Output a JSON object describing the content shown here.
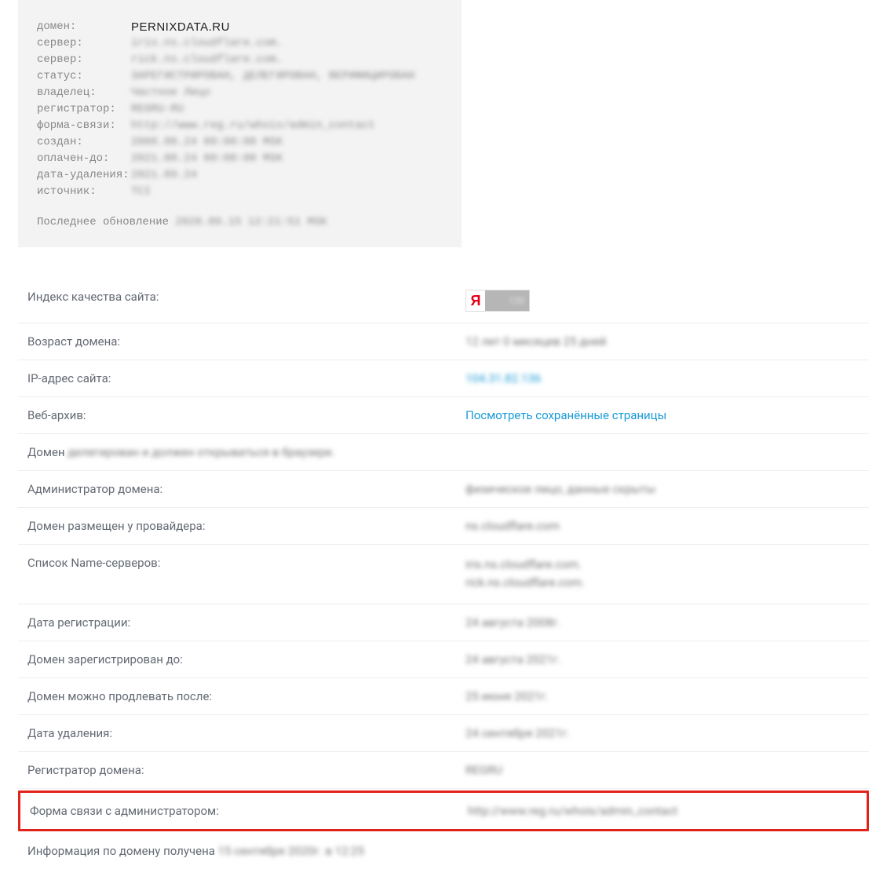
{
  "whois": {
    "rows": [
      {
        "label": "домен:",
        "value": "PERNIXDATA.RU",
        "clear": true
      },
      {
        "label": "сервер:",
        "value": "iris.ns.cloudflare.com."
      },
      {
        "label": "сервер:",
        "value": "rick.ns.cloudflare.com."
      },
      {
        "label": "статус:",
        "value": "ЗАРЕГИСТРИРОВАН, ДЕЛЕГИРОВАН, ВЕРИФИЦИРОВАН"
      },
      {
        "label": "владелец:",
        "value": "Частное Лицо"
      },
      {
        "label": "регистратор:",
        "value": "REGRU-RU"
      },
      {
        "label": "форма-связи:",
        "value": "http://www.reg.ru/whois/admin_contact"
      },
      {
        "label": "создан:",
        "value": "2008.08.24 00:00:00 MSK"
      },
      {
        "label": "оплачен-до:",
        "value": "2021.08.24 00:00:00 MSK"
      },
      {
        "label": "дата-удаления:",
        "value": "2021.09.24"
      },
      {
        "label": "источник:",
        "value": "TCI"
      }
    ],
    "footer_prefix": "Последнее обновление ",
    "footer_value": "2020.09.15 12:21:51 MSK"
  },
  "info": {
    "yandex_label": "Индекс качества сайта:",
    "yandex_y": "Я",
    "yandex_value": "120",
    "age_label": "Возраст домена:",
    "age_value": "12 лет 0 месяцев 25 дней",
    "ip_label": "IP-адрес сайта:",
    "ip_value": "104.31.82.136",
    "archive_label": "Веб-архив:",
    "archive_link": "Посмотреть сохранённые страницы",
    "domain_status_prefix": "Домен ",
    "domain_status_value": "делегирован и должен открываться в браузере.",
    "admin_label": "Администратор домена:",
    "admin_value": "физическое лицо, данные скрыты",
    "provider_label": "Домен размещен у провайдера:",
    "provider_value": "ns.cloudflare.com",
    "ns_label": "Список Name-серверов:",
    "ns_value_1": "iris.ns.cloudflare.com.",
    "ns_value_2": "rick.ns.cloudflare.com.",
    "reg_date_label": "Дата регистрации:",
    "reg_date_value": "24 августа 2008г.",
    "reg_until_label": "Домен зарегистрирован до:",
    "reg_until_value": "24 августа 2021г.",
    "renew_label": "Домен можно продлевать после:",
    "renew_value": "25 июня 2021г.",
    "delete_label": "Дата удаления:",
    "delete_value": "24 сентября 2021г.",
    "registrar_label": "Регистратор домена:",
    "registrar_value": "REGRU",
    "contact_label": "Форма связи с администратором:",
    "contact_value": "http://www.reg.ru/whois/admin_contact",
    "footer_prefix": "Информация по домену получена ",
    "footer_value": "15 сентября 2020г. в 12:25"
  }
}
